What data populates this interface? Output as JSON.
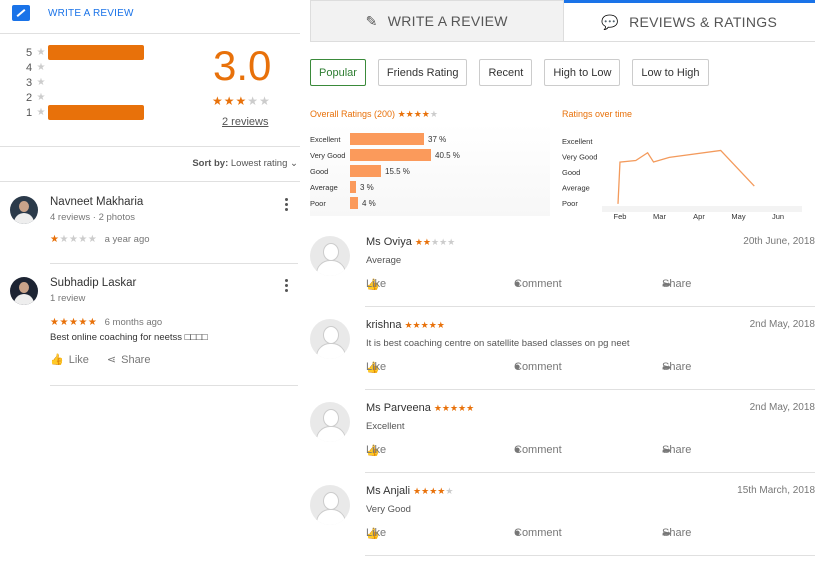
{
  "left": {
    "write_review_label": "WRITE A REVIEW",
    "rating_rows": [
      {
        "num": "5",
        "star": "★",
        "fraction": 1.0
      },
      {
        "num": "4",
        "star": "★",
        "fraction": 0
      },
      {
        "num": "3",
        "star": "★",
        "fraction": 0
      },
      {
        "num": "2",
        "star": "★",
        "fraction": 0
      },
      {
        "num": "1",
        "star": "★",
        "fraction": 1.0
      }
    ],
    "score": "3.0",
    "score_stars": 3,
    "reviews_link": "2 reviews",
    "sort_label": "Sort by:",
    "sort_value": "Lowest rating",
    "reviews": [
      {
        "name": "Navneet Makharia",
        "meta": "4 reviews · 2 photos",
        "stars": 1,
        "time": "a year ago",
        "text": "",
        "like": "",
        "share": ""
      },
      {
        "name": "Subhadip Laskar",
        "meta": "1 review",
        "stars": 5,
        "time": "6 months ago",
        "text": "Best online coaching for neetss □□□□",
        "like": "Like",
        "share": "Share"
      }
    ]
  },
  "tabs": {
    "write": "WRITE A REVIEW",
    "ratings": "REVIEWS & RATINGS"
  },
  "filters": [
    "Popular",
    "Friends Rating",
    "Recent",
    "High to Low",
    "Low to High"
  ],
  "overall": {
    "title": "Overall Ratings (200)",
    "stars": 4,
    "rows": [
      {
        "label": "Excellent",
        "value": 37,
        "pct": "37 %"
      },
      {
        "label": "Very Good",
        "value": 40.5,
        "pct": "40.5 %"
      },
      {
        "label": "Good",
        "value": 15.5,
        "pct": "15.5 %"
      },
      {
        "label": "Average",
        "value": 3,
        "pct": "3 %"
      },
      {
        "label": "Poor",
        "value": 4,
        "pct": "4 %"
      }
    ]
  },
  "chart_data": {
    "type": "line",
    "title": "Ratings over time",
    "categories": [
      "Feb",
      "Mar",
      "Apr",
      "May",
      "Jun"
    ],
    "y_labels": [
      "Excellent",
      "Very Good",
      "Good",
      "Average",
      "Poor"
    ],
    "points": [
      {
        "x": 0.0,
        "y": 1.2
      },
      {
        "x": 0.05,
        "y": 3.9
      },
      {
        "x": 0.45,
        "y": 4.0
      },
      {
        "x": 0.75,
        "y": 4.5
      },
      {
        "x": 0.9,
        "y": 3.9
      },
      {
        "x": 1.3,
        "y": 4.2
      },
      {
        "x": 2.6,
        "y": 4.65
      },
      {
        "x": 3.45,
        "y": 2.35
      }
    ]
  },
  "reviews": [
    {
      "name": "Ms Oviya",
      "stars": 2,
      "date": "20th June, 2018",
      "text": "Average"
    },
    {
      "name": "krishna",
      "stars": 5,
      "date": "2nd May, 2018",
      "text": "It is best coaching centre on satellite based classes on pg neet"
    },
    {
      "name": "Ms Parveena",
      "stars": 5,
      "date": "2nd May, 2018",
      "text": "Excellent"
    },
    {
      "name": "Ms Anjali",
      "stars": 4,
      "date": "15th March, 2018",
      "text": "Very Good"
    }
  ],
  "actions": {
    "like": "Like",
    "comment": "Comment",
    "share": "Share"
  },
  "colors": {
    "accent": "#e8710a",
    "link": "#1a73e8",
    "bar": "#fb9a5b",
    "active_filter": "#2e7d32"
  }
}
